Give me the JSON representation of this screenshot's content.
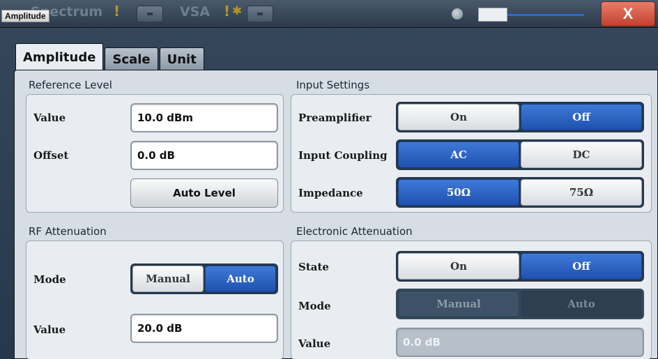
{
  "window": {
    "background_tabs": [
      {
        "label": "Spectrum"
      },
      {
        "label": "VSA"
      }
    ],
    "close_label": "X",
    "dialog_title": "Amplitude"
  },
  "tabs": [
    {
      "label": "Amplitude",
      "active": true
    },
    {
      "label": "Scale",
      "active": false
    },
    {
      "label": "Unit",
      "active": false
    }
  ],
  "reference_level": {
    "header": "Reference Level",
    "value_label": "Value",
    "value": "10.0 dBm",
    "offset_label": "Offset",
    "offset": "0.0 dB",
    "auto_level_label": "Auto Level"
  },
  "input_settings": {
    "header": "Input Settings",
    "preamplifier": {
      "label": "Preamplifier",
      "options": [
        "On",
        "Off"
      ],
      "selected": "Off"
    },
    "input_coupling": {
      "label": "Input Coupling",
      "options": [
        "AC",
        "DC"
      ],
      "selected": "AC"
    },
    "impedance": {
      "label": "Impedance",
      "options": [
        "50Ω",
        "75Ω"
      ],
      "selected": "50Ω"
    }
  },
  "rf_attenuation": {
    "header": "RF Attenuation",
    "mode": {
      "label": "Mode",
      "options": [
        "Manual",
        "Auto"
      ],
      "selected": "Auto"
    },
    "value_label": "Value",
    "value": "20.0 dB"
  },
  "electronic_attenuation": {
    "header": "Electronic Attenuation",
    "state": {
      "label": "State",
      "options": [
        "On",
        "Off"
      ],
      "selected": "Off"
    },
    "mode": {
      "label": "Mode",
      "options": [
        "Manual",
        "Auto"
      ],
      "selected": "Auto",
      "enabled": false
    },
    "value_label": "Value",
    "value": "0.0 dB"
  },
  "colors": {
    "selected_blue": "#2f66c6",
    "frame_dark": "#26384c",
    "close_red": "#d0503c"
  }
}
